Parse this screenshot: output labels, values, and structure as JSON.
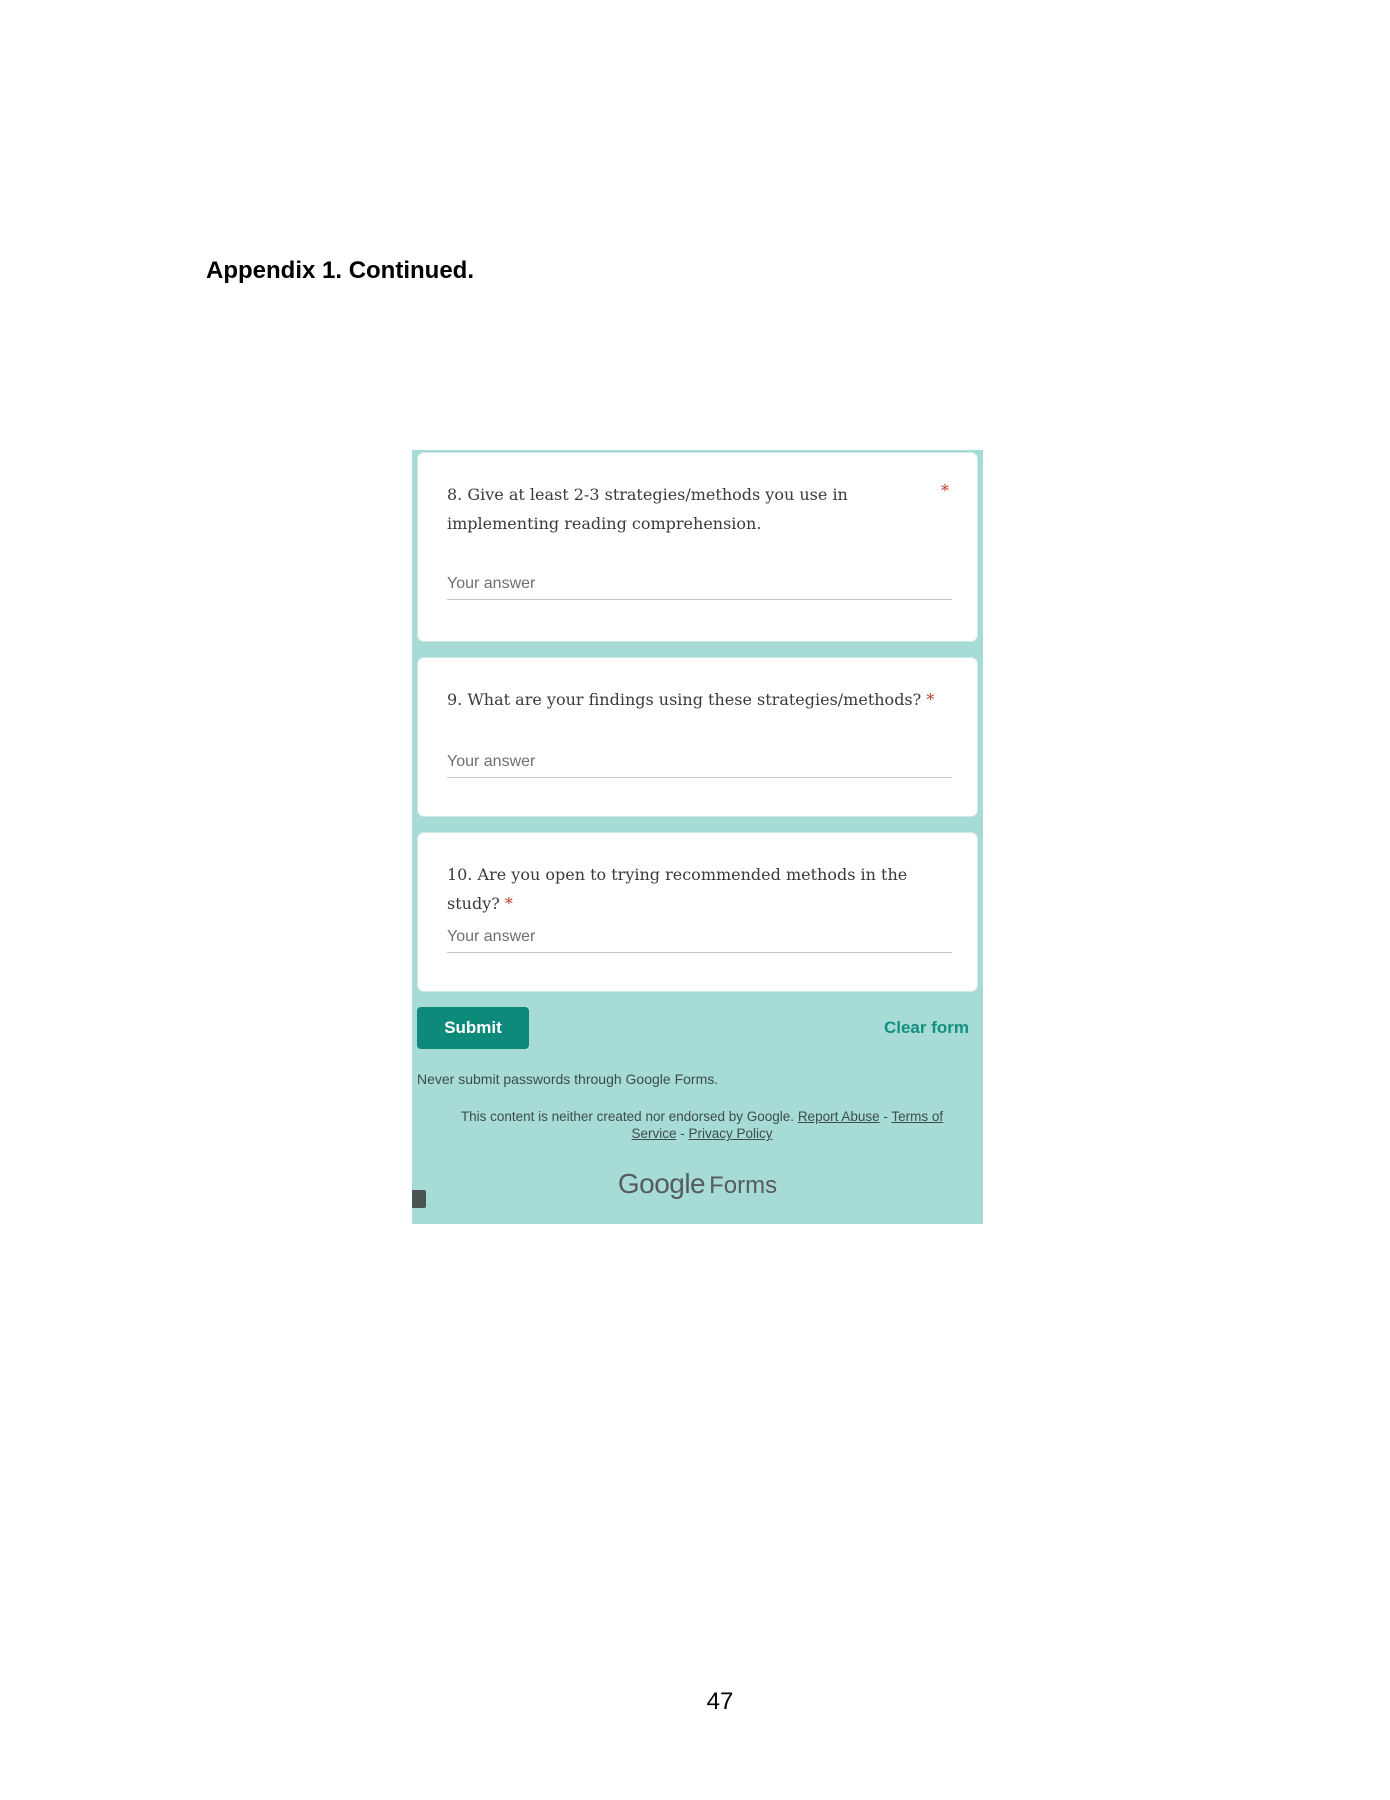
{
  "heading": "Appendix 1. Continued.",
  "page_number": "47",
  "form": {
    "questions": [
      {
        "text": "8. Give at least 2-3 strategies/methods you use in implementing reading comprehension.",
        "required_mark": "*",
        "placeholder": "Your answer"
      },
      {
        "text": "9. What are your findings using these strategies/methods?",
        "required_mark": "*",
        "placeholder": "Your answer"
      },
      {
        "text": "10. Are you open to trying recommended methods in the study?",
        "required_mark": "*",
        "placeholder": "Your answer"
      }
    ],
    "submit_label": "Submit",
    "clear_label": "Clear form",
    "warning": "Never submit passwords through Google Forms.",
    "disclaimer": {
      "text": "This content is neither created nor endorsed by Google.",
      "report_abuse": "Report Abuse",
      "sep1": " - ",
      "terms": "Terms of Service",
      "sep2": " - ",
      "privacy": "Privacy Policy"
    },
    "brand": {
      "google": "Google",
      "forms": "Forms"
    }
  },
  "colors": {
    "form_background": "#a7dcd6",
    "submit_button": "#0d8a7a",
    "required_star": "#c0392b"
  }
}
